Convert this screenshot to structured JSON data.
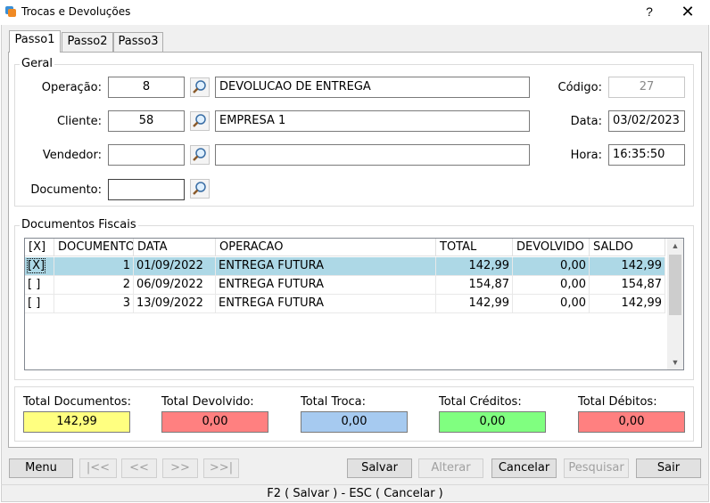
{
  "window": {
    "title": "Trocas e Devoluções",
    "help_label": "?",
    "close_label": "✕"
  },
  "tabs": [
    {
      "label": "Passo1",
      "active": true
    },
    {
      "label": "Passo2",
      "active": false
    },
    {
      "label": "Passo3",
      "active": false
    }
  ],
  "geral": {
    "title": "Geral",
    "operacao": {
      "label": "Operação:",
      "code": "8",
      "description": "DEVOLUCAO DE ENTREGA"
    },
    "cliente": {
      "label": "Cliente:",
      "code": "58",
      "description": "EMPRESA 1"
    },
    "vendedor": {
      "label": "Vendedor:",
      "code": "",
      "description": ""
    },
    "documento": {
      "label": "Documento:",
      "value": ""
    },
    "codigo": {
      "label": "Código:",
      "value": "27"
    },
    "data": {
      "label": "Data:",
      "value": "03/02/2023"
    },
    "hora": {
      "label": "Hora:",
      "value": "16:35:50"
    }
  },
  "documentos": {
    "title": "Documentos Fiscais",
    "columns": [
      "[X]",
      "DOCUMENTO",
      "DATA",
      "OPERACAO",
      "TOTAL",
      "DEVOLVIDO",
      "SALDO"
    ],
    "rows": [
      {
        "check": "[X]",
        "documento": "1",
        "data": "01/09/2022",
        "operacao": "ENTREGA FUTURA",
        "total": "142,99",
        "devolvido": "0,00",
        "saldo": "142,99",
        "selected": true
      },
      {
        "check": "[ ]",
        "documento": "2",
        "data": "06/09/2022",
        "operacao": "ENTREGA FUTURA",
        "total": "154,87",
        "devolvido": "0,00",
        "saldo": "154,87",
        "selected": false
      },
      {
        "check": "[ ]",
        "documento": "3",
        "data": "13/09/2022",
        "operacao": "ENTREGA FUTURA",
        "total": "142,99",
        "devolvido": "0,00",
        "saldo": "142,99",
        "selected": false
      }
    ]
  },
  "totals": [
    {
      "label": "Total Documentos:",
      "value": "142,99",
      "color": "#ffff80"
    },
    {
      "label": "Total Devolvido:",
      "value": "0,00",
      "color": "#ff8080"
    },
    {
      "label": "Total Troca:",
      "value": "0,00",
      "color": "#a6caf0"
    },
    {
      "label": "Total Créditos:",
      "value": "0,00",
      "color": "#80ff80"
    },
    {
      "label": "Total Débitos:",
      "value": "0,00",
      "color": "#ff8080"
    }
  ],
  "buttons": {
    "menu": "Menu",
    "first": "|<<",
    "prev": "<<",
    "next": ">>",
    "last": ">>|",
    "salvar": "Salvar",
    "alterar": "Alterar",
    "cancelar": "Cancelar",
    "pesquisar": "Pesquisar",
    "sair": "Sair"
  },
  "status": "F2 ( Salvar )  -  ESC ( Cancelar )"
}
